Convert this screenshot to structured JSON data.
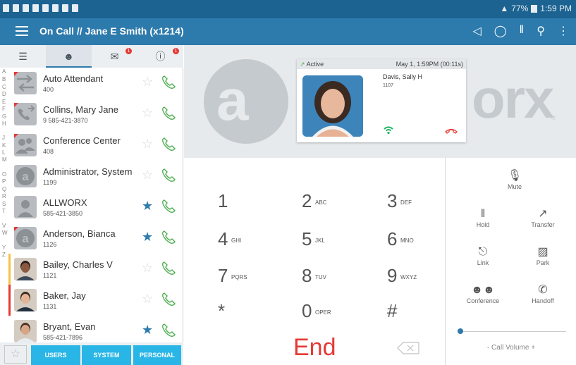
{
  "status_bar": {
    "battery": "77%",
    "time": "1:59 PM"
  },
  "app_bar": {
    "title": "On Call  //  Jane E Smith (x1214)",
    "actions": [
      "speaker-icon",
      "location-icon",
      "voicemail-icon",
      "search-icon",
      "more-icon"
    ]
  },
  "tabs": [
    {
      "icon": "list-icon",
      "badge": ""
    },
    {
      "icon": "contacts-icon",
      "badge": ""
    },
    {
      "icon": "mail-icon",
      "badge": "1"
    },
    {
      "icon": "info-icon",
      "badge": "1"
    }
  ],
  "alphabet": [
    "A",
    "B",
    "C",
    "D",
    "E",
    "F",
    "G",
    "H",
    "J",
    "K",
    "L",
    "M",
    "O",
    "P",
    "Q",
    "R",
    "S",
    "T",
    "V",
    "W",
    "Y",
    "Z"
  ],
  "contacts": [
    {
      "name": "Auto Attendant",
      "sub": "400",
      "favorite": false,
      "avatar": "auto-attendant-icon",
      "flag": true,
      "bar": ""
    },
    {
      "name": "Collins, Mary Jane",
      "sub": "9 585-421-3870",
      "favorite": false,
      "avatar": "outside-call-icon",
      "flag": true,
      "bar": ""
    },
    {
      "name": "Conference Center",
      "sub": "408",
      "favorite": false,
      "avatar": "conference-icon",
      "flag": true,
      "bar": ""
    },
    {
      "name": "Administrator, System",
      "sub": "1199",
      "favorite": false,
      "avatar": "allworx-logo-icon",
      "flag": false,
      "bar": ""
    },
    {
      "name": "ALLWORX",
      "sub": "585-421-3850",
      "favorite": true,
      "avatar": "person-icon",
      "flag": false,
      "bar": ""
    },
    {
      "name": "Anderson, Bianca",
      "sub": "1126",
      "favorite": true,
      "avatar": "allworx-logo-icon",
      "flag": true,
      "bar": ""
    },
    {
      "name": "Bailey, Charles V",
      "sub": "1121",
      "favorite": false,
      "avatar": "photo",
      "flag": false,
      "bar": "#f5c242"
    },
    {
      "name": "Baker, Jay",
      "sub": "1131",
      "favorite": false,
      "avatar": "photo",
      "flag": false,
      "bar": "#e53935"
    },
    {
      "name": "Bryant, Evan",
      "sub": "585-421-7896",
      "favorite": true,
      "avatar": "photo",
      "flag": false,
      "bar": ""
    }
  ],
  "bottom_buttons": [
    "USERS",
    "SYSTEM",
    "PERSONAL"
  ],
  "active_call": {
    "state": "Active",
    "timestamp": "May 1, 1:59PM (00:11s)",
    "caller_name": "Davis, Sally H",
    "caller_ext": "1107"
  },
  "dialpad": [
    {
      "num": "1",
      "letters": ""
    },
    {
      "num": "2",
      "letters": "ABC"
    },
    {
      "num": "3",
      "letters": "DEF"
    },
    {
      "num": "4",
      "letters": "GHI"
    },
    {
      "num": "5",
      "letters": "JKL"
    },
    {
      "num": "6",
      "letters": "MNO"
    },
    {
      "num": "7",
      "letters": "PQRS"
    },
    {
      "num": "8",
      "letters": "TUV"
    },
    {
      "num": "9",
      "letters": "WXYZ"
    },
    {
      "num": "*",
      "letters": ""
    },
    {
      "num": "0",
      "letters": "OPER"
    },
    {
      "num": "#",
      "letters": ""
    }
  ],
  "end_label": "End",
  "controls": {
    "mute": "Mute",
    "hold": "Hold",
    "transfer": "Transfer",
    "link": "Link",
    "park": "Park",
    "conference": "Conference",
    "handoff": "Handoff"
  },
  "volume_label": "- Call Volume +",
  "volume_level": 0.0,
  "colors": {
    "status_bar": "#1c6391",
    "app_bar": "#2d7aac",
    "accent": "#29b6e6",
    "phone_green": "#4caf50",
    "end_red": "#e53935"
  }
}
